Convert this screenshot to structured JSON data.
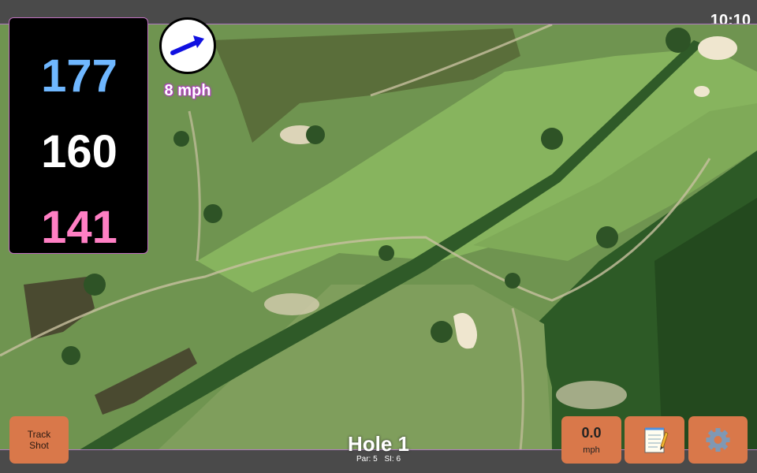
{
  "status_bar": {
    "time": "10:10"
  },
  "distances": {
    "back": "177",
    "middle": "160",
    "front": "141"
  },
  "colors": {
    "back": "#6fb7ff",
    "middle": "#ffffff",
    "front": "#ff7fc4",
    "button": "#d9784a",
    "accent": "#b07ac0"
  },
  "wind": {
    "speed": "8 mph",
    "direction_icon": "arrow-up-right-icon"
  },
  "buttons": {
    "track_shot": "Track\nShot",
    "speed_value": "0.0",
    "speed_unit": "mph",
    "notes_icon": "notepad-icon",
    "settings_icon": "gear-icon"
  },
  "hole": {
    "title": "Hole 1",
    "par": "Par: 5",
    "si": "SI: 6"
  }
}
